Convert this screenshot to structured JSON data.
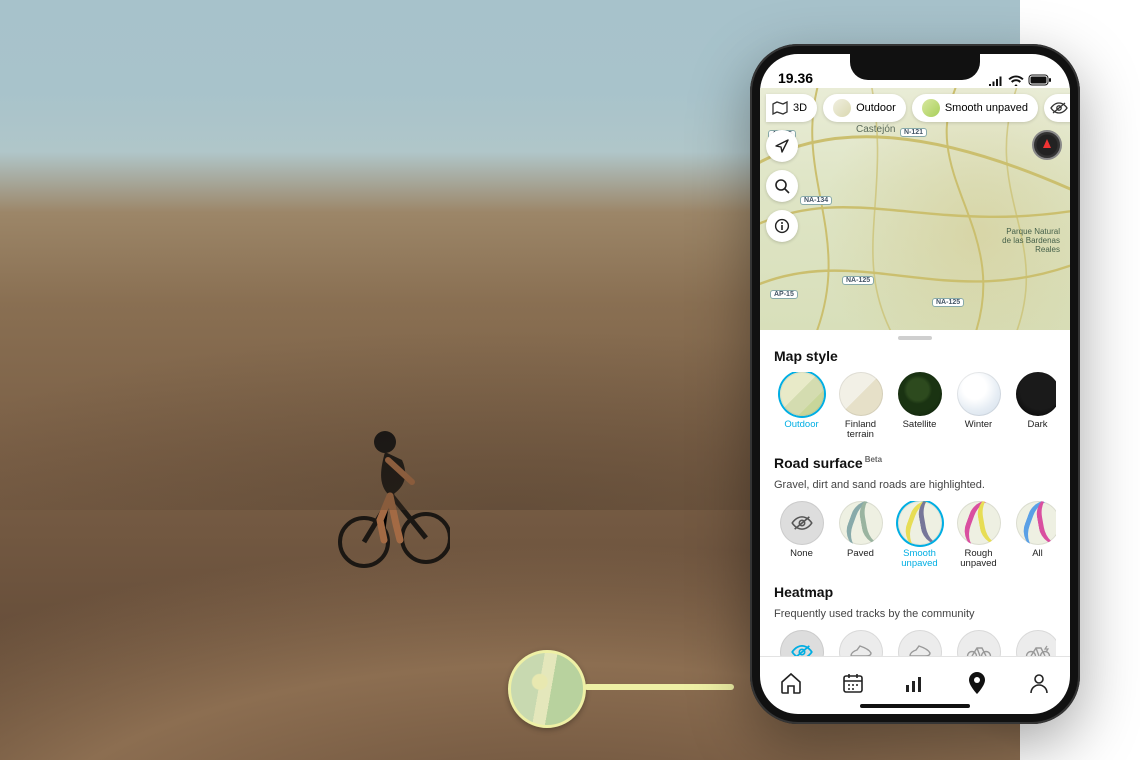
{
  "status": {
    "time": "19.36"
  },
  "map": {
    "chips": {
      "threeD": "3D",
      "style": "Outdoor",
      "surface": "Smooth unpaved"
    },
    "roads": {
      "ap15a": "AP-15",
      "ap15b": "AP-15",
      "n121": "N-121",
      "na134": "NA-134",
      "na125a": "NA-125",
      "na125b": "NA-125"
    },
    "places": {
      "castejon": "Castejón",
      "park_l1": "Parque Natural",
      "park_l2": "de las Bardenas",
      "park_l3": "Reales"
    }
  },
  "panel": {
    "mapStyle": {
      "title": "Map style",
      "items": [
        {
          "label": "Outdoor"
        },
        {
          "label": "Finland terrain"
        },
        {
          "label": "Satellite"
        },
        {
          "label": "Winter"
        },
        {
          "label": "Dark"
        }
      ]
    },
    "roadSurface": {
      "title": "Road surface",
      "beta": "Beta",
      "sub": "Gravel, dirt and sand roads are highlighted.",
      "items": [
        {
          "label": "None"
        },
        {
          "label": "Paved"
        },
        {
          "label": "Smooth unpaved"
        },
        {
          "label": "Rough unpaved"
        },
        {
          "label": "All"
        }
      ]
    },
    "heatmap": {
      "title": "Heatmap",
      "sub": "Frequently used tracks by the community"
    }
  }
}
